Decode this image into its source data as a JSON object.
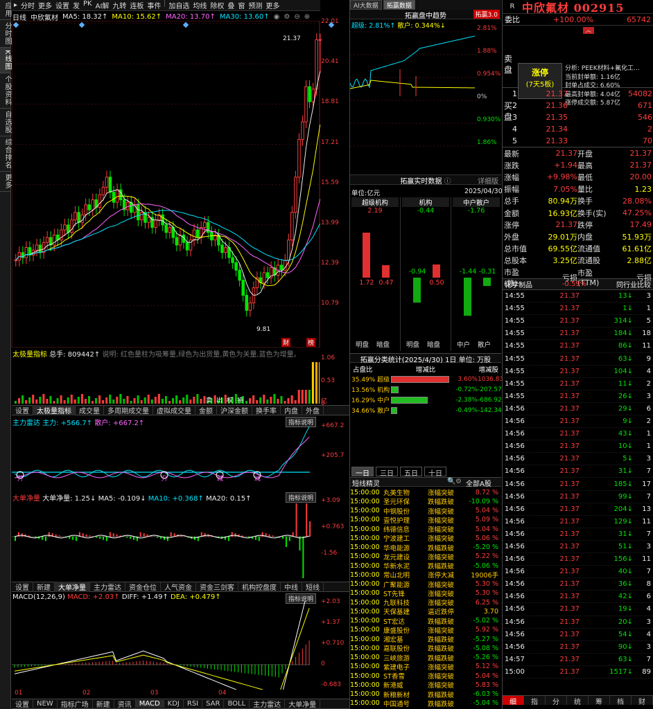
{
  "left_tabs": [
    "应用",
    "分时图",
    "K线图",
    "个股资料",
    "自选股",
    "综合排名",
    "更多"
  ],
  "topbar": [
    "分时",
    "更多",
    "设置",
    "发",
    "PK",
    "AI解",
    "九转",
    "连板",
    "事件",
    "加自选",
    "均线",
    "除权",
    "叠",
    "窗",
    "预测",
    "更多"
  ],
  "kline": {
    "label": "日线",
    "name": "中欣氟材",
    "ma5": "MA5: 18.32↑",
    "ma10": "MA10: 15.62↑",
    "ma20": "MA20: 13.70↑",
    "ma30": "MA30: 13.60↑",
    "high_label": "21.37",
    "low_label": "9.81",
    "axis": [
      "22.01",
      "20.41",
      "18.81",
      "17.21",
      "15.59",
      "13.99",
      "12.39",
      "10.79"
    ],
    "tag1": "财",
    "tag2": "榜"
  },
  "vol": {
    "title": "太极量指标",
    "total": "总手: 809442↑",
    "note": "说明: 红色量柱为吸筹量,绿色为出货量,黄色为关量,蓝色为增量。",
    "axis": [
      "1.06",
      "0.53",
      "0"
    ],
    "unit": "亿",
    "markers": [
      "卖",
      "出",
      "权",
      "持"
    ]
  },
  "tabs1": [
    "设置",
    "太极量指标",
    "成交量",
    "多周期成交量",
    "虚拟成交量",
    "金额",
    "沪深金额",
    "换手率",
    "内盘",
    "外盘"
  ],
  "zl": {
    "title": "主力雷达",
    "main": "主力: +566.7↑",
    "retail": "散户: +667.2↑",
    "axis": [
      "+667.2",
      "+205.7"
    ],
    "explain": "指标说明",
    "marks": [
      "升",
      "升",
      "减",
      "减"
    ]
  },
  "dd": {
    "title": "大单净量",
    "val": "大单净量: 1.25↓",
    "ma5": "MA5: -0.109↓",
    "ma10": "MA10: +0.368↑",
    "ma20": "MA20: 0.15↑",
    "axis": [
      "+3.09",
      "+0.763",
      "-1.56"
    ],
    "explain": "指标说明"
  },
  "tabs2": [
    "设置",
    "新建",
    "大单净量",
    "主力雷达",
    "资金仓位",
    "人气资金",
    "资金三剑客",
    "机构控盘度",
    "中线",
    "短线"
  ],
  "macd": {
    "title": "MACD(12,26,9)",
    "macd": "MACD: +2.03↑",
    "diff": "DIFF: +1.49↑",
    "dea": "DEA: +0.479↑",
    "axis": [
      "+2.03",
      "+1.37",
      "+0.710",
      "0",
      "-0.683"
    ],
    "explain": "指标说明",
    "months": [
      "01",
      "02",
      "03",
      "04"
    ]
  },
  "bottomtabs": [
    "设置",
    "NEW",
    "指标广场",
    "新建",
    "资讯",
    "MACD",
    "KDJ",
    "RSI",
    "SAR",
    "BOLL",
    "主力雷达",
    "大单净量"
  ],
  "mid": {
    "tabs": [
      "AI大数据",
      "拓赢数据"
    ],
    "chart_title": "拓赢盘中趋势",
    "badge": "拓赢3.0",
    "super": "超级: 2.81%↑",
    "retail": "散户: 0.344%↓",
    "axis": [
      "2.81%",
      "1.88%",
      "0.954%",
      "0%",
      "0.930%",
      "1.86%"
    ],
    "realtime": "拓赢实时数据",
    "detail": "详细版",
    "unit": "单位:亿元",
    "date": "2025/04/30",
    "groups": [
      {
        "name": "超级机构",
        "top": "2.19",
        "a": "1.72",
        "b": "0.47"
      },
      {
        "name": "机构",
        "top": "-0.44",
        "a": "-0.94",
        "b": "0.50"
      },
      {
        "name": "中户散户",
        "top": "-1.76",
        "a": "-1.44",
        "b": "-0.31"
      }
    ],
    "bar_labels": [
      "明盘",
      "暗盘",
      "明盘",
      "暗盘",
      "中户",
      "散户"
    ],
    "stats_title": "拓赢分类统计(2025/4/30)",
    "stats_period": "1日",
    "stats_unit": "单位: 万股",
    "stats_head": [
      "占盘比",
      "增减比",
      "增减股"
    ],
    "stats": [
      {
        "pct": "35.49%",
        "name": "超级",
        "chg": "3.60%",
        "shares": "1036.83",
        "fill": 0.95,
        "color": "#e03030"
      },
      {
        "pct": "13.56%",
        "name": "机构",
        "chg": "-0.72%",
        "shares": "-207.57",
        "fill": 0.12,
        "color": "#22bb22"
      },
      {
        "pct": "16.29%",
        "name": "中户",
        "chg": "-2.38%",
        "shares": "-686.92",
        "fill": 0.6,
        "color": "#22bb22"
      },
      {
        "pct": "34.66%",
        "name": "散户",
        "chg": "-0.49%",
        "shares": "-142.34",
        "fill": 0.1,
        "color": "#22bb22"
      }
    ],
    "periods": [
      "一日",
      "三日",
      "五日",
      "十日"
    ],
    "news_title": "短线精灵",
    "news_filter": "全部A股",
    "news": [
      [
        "15:00:00",
        "丸美生物",
        "涨幅突破",
        "8.72 %",
        "r"
      ],
      [
        "15:00:00",
        "圣元环保",
        "跌幅跌破",
        "-10.09 %",
        "g"
      ],
      [
        "15:00:00",
        "中钢股份",
        "涨幅突破",
        "5.04 %",
        "r"
      ],
      [
        "15:00:00",
        "壹悦护理",
        "涨幅突破",
        "5.09 %",
        "r"
      ],
      [
        "15:00:00",
        "纬德信息",
        "涨幅突破",
        "5.04 %",
        "r"
      ],
      [
        "15:00:00",
        "宁波建工",
        "涨幅突破",
        "5.06 %",
        "r"
      ],
      [
        "15:00:00",
        "华电能源",
        "跌幅跌破",
        "-5.20 %",
        "g"
      ],
      [
        "15:00:00",
        "龙元建设",
        "涨幅突破",
        "5.22 %",
        "r"
      ],
      [
        "15:00:00",
        "华新水泥",
        "跌幅跌破",
        "-5.06 %",
        "g"
      ],
      [
        "15:00:00",
        "常山北明",
        "涨停大减",
        "19006手",
        "y"
      ],
      [
        "15:00:00",
        "广聚能源",
        "涨幅突破",
        "5.30 %",
        "r"
      ],
      [
        "15:00:00",
        "ST先锋",
        "涨幅突破",
        "5.30 %",
        "r"
      ],
      [
        "15:00:00",
        "九联科技",
        "涨幅突破",
        "6.25 %",
        "r"
      ],
      [
        "15:00:00",
        "天保基建",
        "逼近跌停",
        "3.70",
        "y"
      ],
      [
        "15:00:00",
        "ST宏达",
        "跌幅跌破",
        "-5.02 %",
        "g"
      ],
      [
        "15:00:00",
        "康盛股份",
        "涨幅突破",
        "5.92 %",
        "r"
      ],
      [
        "15:00:00",
        "湘宏基",
        "跌幅跌破",
        "-5.27 %",
        "g"
      ],
      [
        "15:00:00",
        "嘉联股份",
        "跌幅跌破",
        "-5.08 %",
        "g"
      ],
      [
        "15:00:00",
        "三峡旅游",
        "跌幅跌破",
        "-5.26 %",
        "g"
      ],
      [
        "15:00:00",
        "紫建电子",
        "涨幅突破",
        "5.12 %",
        "r"
      ],
      [
        "15:00:00",
        "ST香雪",
        "涨幅突破",
        "5.04 %",
        "r"
      ],
      [
        "15:00:00",
        "新港威",
        "涨幅突破",
        "5.83 %",
        "r"
      ],
      [
        "15:00:00",
        "新粮新材",
        "跌幅跌破",
        "-6.03 %",
        "g"
      ],
      [
        "15:00:00",
        "中国通号",
        "跌幅跌破",
        "-5.04 %",
        "g"
      ]
    ]
  },
  "right": {
    "r": "R",
    "name": "中欣氟材 002915",
    "wb_label": "委比",
    "wb_pct": "+100.00%",
    "wb_val": "65742",
    "sell": "卖盘",
    "buy": "买盘",
    "limit": "涨停",
    "limit_sub": "(7天5板)",
    "analysis": [
      "分析: PEEK材料+氟化工...",
      "当前封单额: 1.16亿",
      "封单占成交: 6.60%",
      "最高封单额: 4.04亿",
      "涨停成交额: 5.87亿"
    ],
    "bids": [
      [
        "1",
        "21.37",
        "54082"
      ],
      [
        "2",
        "21.36",
        "671"
      ],
      [
        "3",
        "21.35",
        "546"
      ],
      [
        "4",
        "21.34",
        "2"
      ],
      [
        "5",
        "21.33",
        "70"
      ]
    ],
    "quotes": [
      [
        "最新",
        "21.37",
        "开盘",
        "21.37"
      ],
      [
        "涨跌",
        "+1.94",
        "最高",
        "21.37"
      ],
      [
        "涨幅",
        "+9.98%",
        "最低",
        "20.00"
      ],
      [
        "振幅",
        "7.05%",
        "量比",
        "1.23"
      ],
      [
        "总手",
        "80.94万",
        "换手",
        "28.08%"
      ],
      [
        "金额",
        "16.93亿",
        "换手(实)",
        "47.25%"
      ],
      [
        "涨停",
        "21.37",
        "跌停",
        "17.49"
      ],
      [
        "外盘",
        "29.01万",
        "内盘",
        "51.93万"
      ],
      [
        "总市值",
        "69.55亿",
        "流通值",
        "61.61亿"
      ],
      [
        "总股本",
        "3.25亿",
        "流通股",
        "2.88亿"
      ],
      [
        "市盈(静)",
        "亏损",
        "市盈(TTM)",
        "亏损"
      ]
    ],
    "industry": "化学制品",
    "industry_chg": "-0.59%",
    "industry_rank": "同行业比较",
    "ticks": [
      [
        "14:55",
        "21.37",
        "13",
        "3"
      ],
      [
        "14:55",
        "21.37",
        "1",
        "1"
      ],
      [
        "14:55",
        "21.37",
        "314",
        "5"
      ],
      [
        "14:55",
        "21.37",
        "184",
        "18"
      ],
      [
        "14:55",
        "21.37",
        "86",
        "11"
      ],
      [
        "14:55",
        "21.37",
        "63",
        "9"
      ],
      [
        "14:55",
        "21.37",
        "104",
        "4"
      ],
      [
        "14:55",
        "21.37",
        "11",
        "2"
      ],
      [
        "14:55",
        "21.37",
        "26",
        "3"
      ],
      [
        "14:56",
        "21.37",
        "29",
        "6"
      ],
      [
        "14:56",
        "21.37",
        "9",
        "2"
      ],
      [
        "14:56",
        "21.37",
        "43",
        "1"
      ],
      [
        "14:56",
        "21.37",
        "10",
        "1"
      ],
      [
        "14:56",
        "21.37",
        "5",
        "3"
      ],
      [
        "14:56",
        "21.37",
        "31",
        "7"
      ],
      [
        "14:56",
        "21.37",
        "185",
        "17"
      ],
      [
        "14:56",
        "21.37",
        "99",
        "7"
      ],
      [
        "14:56",
        "21.37",
        "204",
        "13"
      ],
      [
        "14:56",
        "21.37",
        "129",
        "11"
      ],
      [
        "14:56",
        "21.37",
        "31",
        "7"
      ],
      [
        "14:56",
        "21.37",
        "51",
        "3"
      ],
      [
        "14:56",
        "21.37",
        "156",
        "11"
      ],
      [
        "14:56",
        "21.37",
        "40",
        "7"
      ],
      [
        "14:56",
        "21.37",
        "36",
        "8"
      ],
      [
        "14:56",
        "21.37",
        "42",
        "6"
      ],
      [
        "14:56",
        "21.37",
        "19",
        "4"
      ],
      [
        "14:56",
        "21.37",
        "20",
        "3"
      ],
      [
        "14:56",
        "21.37",
        "54",
        "4"
      ],
      [
        "14:56",
        "21.37",
        "90",
        "3"
      ],
      [
        "14:57",
        "21.37",
        "63",
        "7"
      ],
      [
        "15:00",
        "21.37",
        "1517",
        "89"
      ]
    ],
    "bottom_tabs": [
      "细",
      "指",
      "分",
      "统",
      "筹",
      "档",
      "财"
    ]
  }
}
